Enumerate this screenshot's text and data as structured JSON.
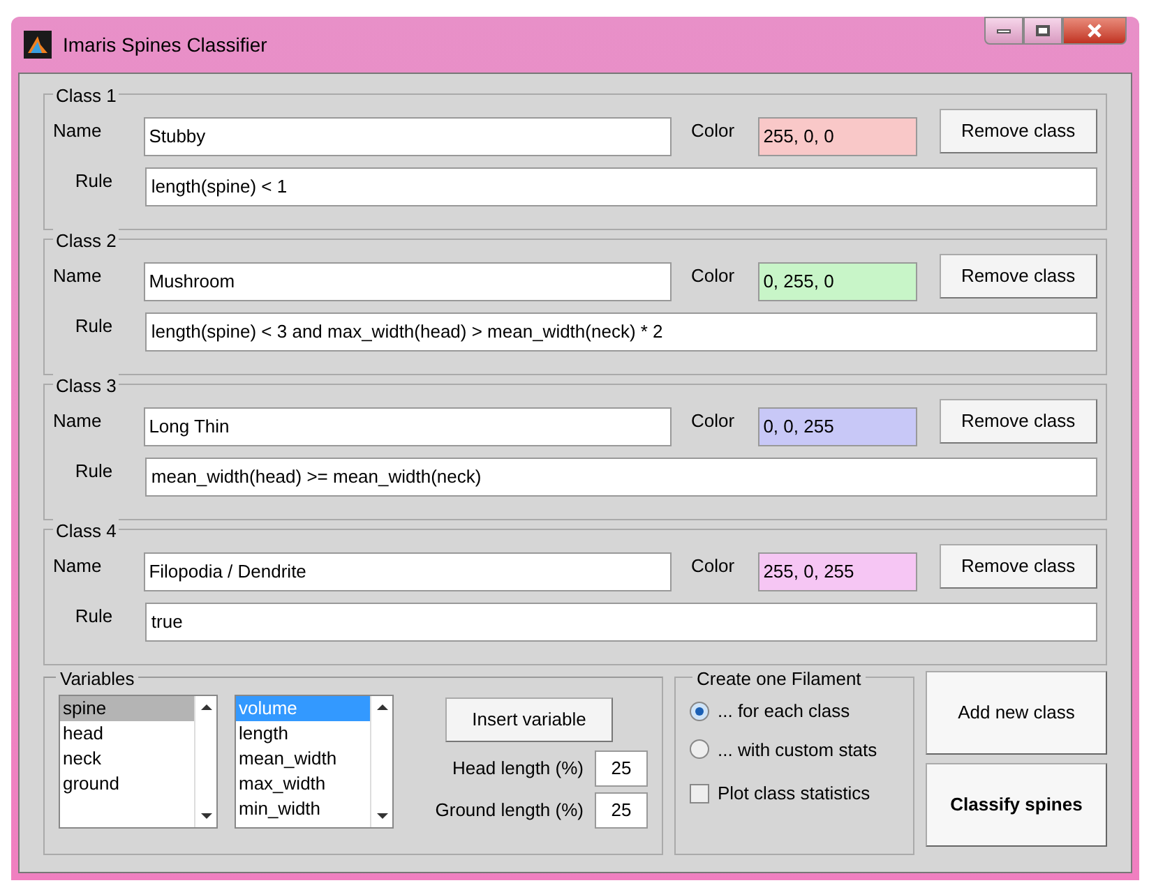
{
  "window": {
    "title": "Imaris Spines Classifier"
  },
  "classes": [
    {
      "legend": "Class 1",
      "name_label": "Name",
      "name": "Stubby",
      "color_label": "Color",
      "color_value": "255, 0, 0",
      "color": "#f9c8c8",
      "remove": "Remove class",
      "rule_label": "Rule",
      "rule": "length(spine) < 1"
    },
    {
      "legend": "Class 2",
      "name_label": "Name",
      "name": "Mushroom",
      "color_label": "Color",
      "color_value": "0, 255, 0",
      "color": "#c8f5c8",
      "remove": "Remove class",
      "rule_label": "Rule",
      "rule": "length(spine) < 3 and max_width(head) > mean_width(neck) * 2"
    },
    {
      "legend": "Class 3",
      "name_label": "Name",
      "name": "Long Thin",
      "color_label": "Color",
      "color_value": "0, 0, 255",
      "color": "#c8c8f7",
      "remove": "Remove class",
      "rule_label": "Rule",
      "rule": "mean_width(head) >= mean_width(neck)"
    },
    {
      "legend": "Class 4",
      "name_label": "Name",
      "name": "Filopodia / Dendrite",
      "color_label": "Color",
      "color_value": "255, 0, 255",
      "color": "#f6c6f4",
      "remove": "Remove class",
      "rule_label": "Rule",
      "rule": "true"
    }
  ],
  "variables": {
    "legend": "Variables",
    "objects": [
      {
        "label": "spine",
        "selected": true
      },
      {
        "label": "head",
        "selected": false
      },
      {
        "label": "neck",
        "selected": false
      },
      {
        "label": "ground",
        "selected": false
      }
    ],
    "measures": [
      {
        "label": "volume",
        "selected": true
      },
      {
        "label": "length",
        "selected": false
      },
      {
        "label": "mean_width",
        "selected": false
      },
      {
        "label": "max_width",
        "selected": false
      },
      {
        "label": "min_width",
        "selected": false
      }
    ],
    "insert": "Insert variable",
    "params": [
      {
        "label": "Head length (%)",
        "value": "25"
      },
      {
        "label": "Ground length (%)",
        "value": "25"
      }
    ]
  },
  "filament": {
    "legend": "Create one Filament",
    "options": [
      {
        "label": "... for each class",
        "selected": true
      },
      {
        "label": "... with custom stats",
        "selected": false
      }
    ],
    "plot": {
      "label": "Plot class statistics",
      "checked": false
    }
  },
  "buttons": [
    {
      "label": "Add new class",
      "bold": false
    },
    {
      "label": "Classify spines",
      "bold": true
    }
  ]
}
